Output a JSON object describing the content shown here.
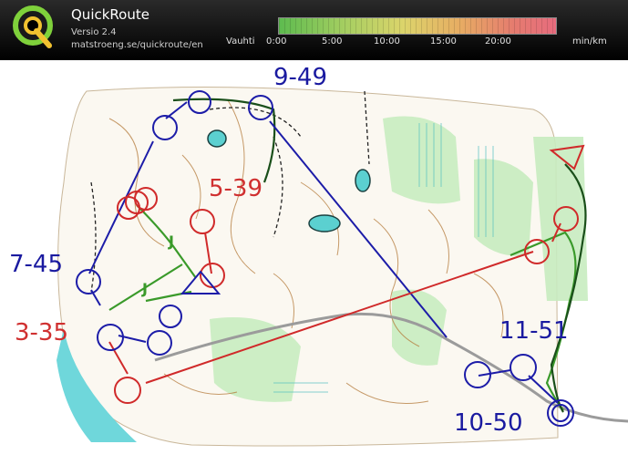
{
  "header": {
    "title": "QuickRoute",
    "version": "Versio 2.4",
    "url": "matstroeng.se/quickroute/en",
    "pace_label": "Vauhti",
    "pace_ticks": [
      "0:00",
      "5:00",
      "10:00",
      "15:00",
      "20:00"
    ],
    "pace_unit": "min/km"
  },
  "map": {
    "split_labels": [
      {
        "text": "9-49",
        "color": "#1a1aa0"
      },
      {
        "text": "5-39",
        "color": "#d03030"
      },
      {
        "text": "7-45",
        "color": "#1a1aa0"
      },
      {
        "text": "3-35",
        "color": "#d03030"
      },
      {
        "text": "11-51",
        "color": "#1a1aa0"
      },
      {
        "text": "10-50",
        "color": "#1a1aa0"
      }
    ],
    "j_markers": [
      "J",
      "J"
    ],
    "colors": {
      "route_blue": "#1c1ca8",
      "route_red": "#d02a2a",
      "route_green": "#3a9a2a",
      "water": "#5bd0d0",
      "contour": "#b47a3a"
    }
  }
}
